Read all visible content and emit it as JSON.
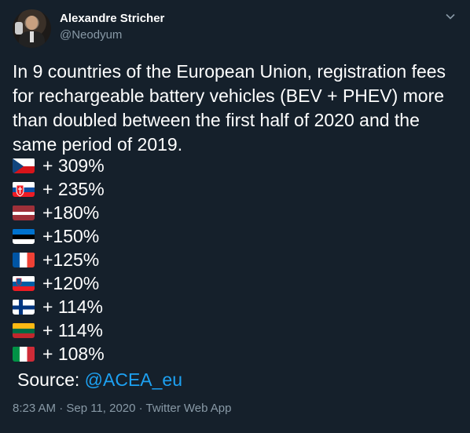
{
  "author": {
    "name": "Alexandre Stricher",
    "handle": "@Neodyum"
  },
  "tweet": {
    "lines": [
      "In 9 countries of the European Union, registration fees",
      "for rechargeable battery vehicles (BEV + PHEV) more",
      "than doubled between the first half of 2020 and the",
      "same period of 2019."
    ],
    "items": [
      {
        "flag": "czech-flag-icon",
        "value": "+ 309%"
      },
      {
        "flag": "slovakia-flag-icon",
        "value": "+ 235%"
      },
      {
        "flag": "latvia-flag-icon",
        "value": "+180%"
      },
      {
        "flag": "estonia-flag-icon",
        "value": "+150%"
      },
      {
        "flag": "france-flag-icon",
        "value": "+125%"
      },
      {
        "flag": "slovenia-flag-icon",
        "value": "+120%"
      },
      {
        "flag": "finland-flag-icon",
        "value": "+ 114%"
      },
      {
        "flag": "lithuania-flag-icon",
        "value": "+ 114%"
      },
      {
        "flag": "italy-flag-icon",
        "value": "+ 108%"
      }
    ],
    "source_label": "Source:",
    "source_link": "@ACEA_eu"
  },
  "meta": {
    "timestamp": "8:23 AM · Sep 11, 2020 · Twitter Web App"
  },
  "colors": {
    "background": "#15202b",
    "text": "#ffffff",
    "muted": "#8899a6",
    "link": "#1da1f2"
  }
}
